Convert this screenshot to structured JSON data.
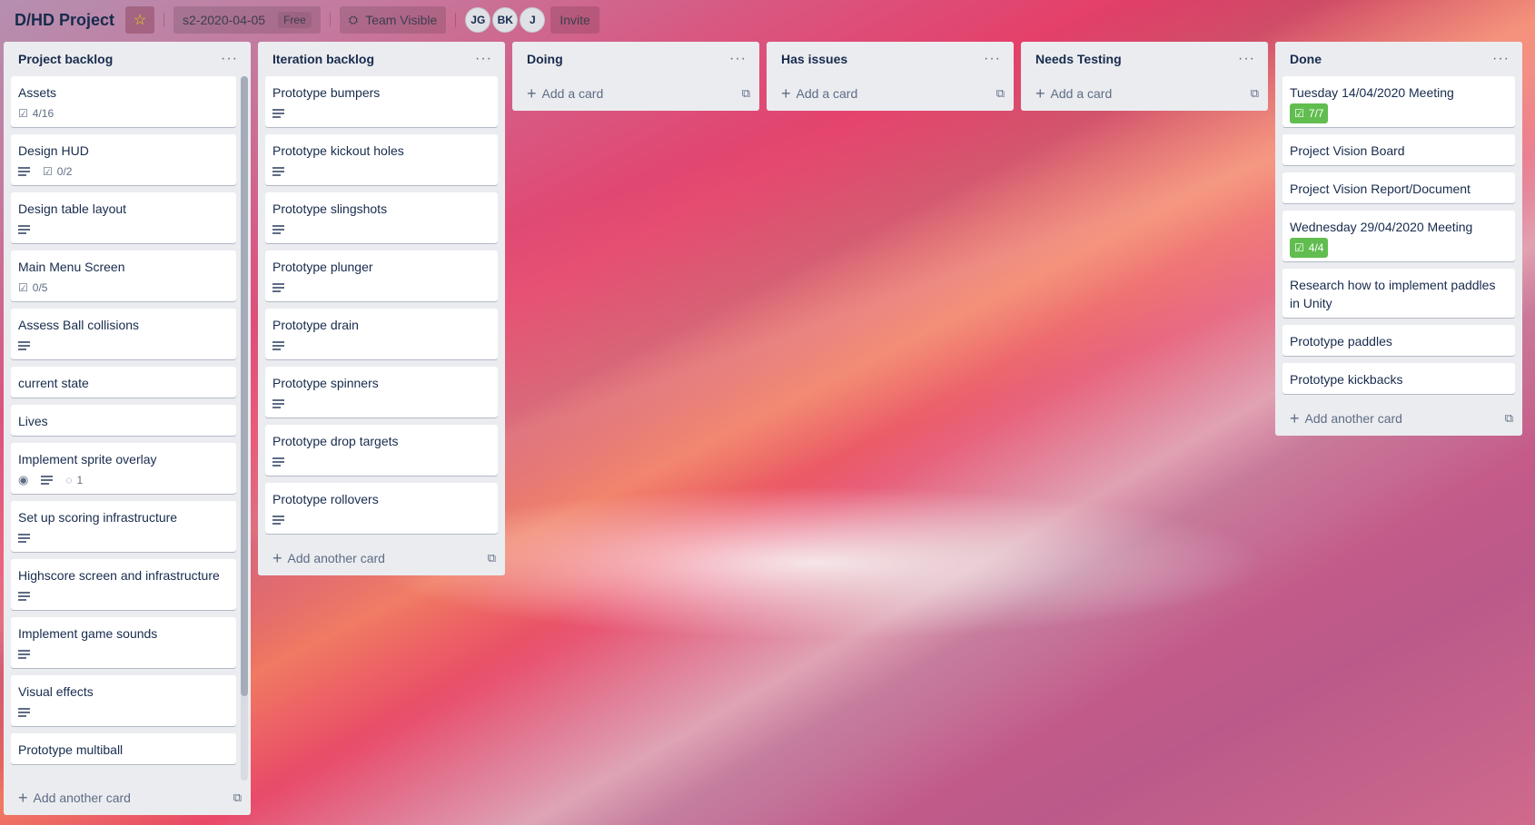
{
  "header": {
    "board_title": "D/HD Project",
    "board_name_tag": "s2-2020-04-05",
    "plan": "Free",
    "visibility": "Team Visible",
    "members": [
      "JG",
      "BK",
      "J"
    ],
    "invite_label": "Invite"
  },
  "lists": [
    {
      "title": "Project backlog",
      "cards": [
        {
          "title": "Assets",
          "checklist": "4/16"
        },
        {
          "title": "Design HUD",
          "desc": true,
          "checklist": "0/2"
        },
        {
          "title": "Design table layout",
          "desc": true
        },
        {
          "title": "Main Menu Screen",
          "checklist": "0/5"
        },
        {
          "title": "Assess Ball collisions",
          "desc": true
        },
        {
          "title": "current state"
        },
        {
          "title": "Lives"
        },
        {
          "title": "Implement sprite overlay",
          "watch": true,
          "desc": true,
          "comments": "1"
        },
        {
          "title": "Set up scoring infrastructure",
          "desc": true
        },
        {
          "title": "Highscore screen and infrastructure",
          "desc": true
        },
        {
          "title": "Implement game sounds",
          "desc": true
        },
        {
          "title": "Visual effects",
          "desc": true
        },
        {
          "title": "Prototype multiball"
        }
      ],
      "add_label": "Add another card"
    },
    {
      "title": "Iteration backlog",
      "cards": [
        {
          "title": "Prototype bumpers",
          "desc": true
        },
        {
          "title": "Prototype kickout holes",
          "desc": true
        },
        {
          "title": "Prototype slingshots",
          "desc": true
        },
        {
          "title": "Prototype plunger",
          "desc": true
        },
        {
          "title": "Prototype drain",
          "desc": true
        },
        {
          "title": "Prototype spinners",
          "desc": true
        },
        {
          "title": "Prototype drop targets",
          "desc": true
        },
        {
          "title": "Prototype rollovers",
          "desc": true
        }
      ],
      "add_label": "Add another card"
    },
    {
      "title": "Doing",
      "cards": [],
      "add_label": "Add a card"
    },
    {
      "title": "Has issues",
      "cards": [],
      "add_label": "Add a card"
    },
    {
      "title": "Needs Testing",
      "cards": [],
      "add_label": "Add a card"
    },
    {
      "title": "Done",
      "cards": [
        {
          "title": "Tuesday 14/04/2020 Meeting",
          "checklist_complete": "7/7"
        },
        {
          "title": "Project Vision Board"
        },
        {
          "title": "Project Vision Report/Document"
        },
        {
          "title": "Wednesday 29/04/2020 Meeting",
          "checklist_complete": "4/4"
        },
        {
          "title": "Research how to implement paddles in Unity"
        },
        {
          "title": "Prototype paddles"
        },
        {
          "title": "Prototype kickbacks"
        }
      ],
      "add_label": "Add another card"
    }
  ],
  "colors": {
    "list_bg": "#ebecf0",
    "card_bg": "#ffffff",
    "complete_badge": "#61bd4f",
    "star": "#f2d600"
  },
  "icons": {
    "star": "star-icon",
    "team": "team-icon",
    "description": "description-icon",
    "checklist": "checklist-icon",
    "watch": "eye-icon",
    "comment": "comment-icon",
    "add": "plus-icon",
    "template": "card-template-icon",
    "menu": "ellipsis-icon"
  }
}
